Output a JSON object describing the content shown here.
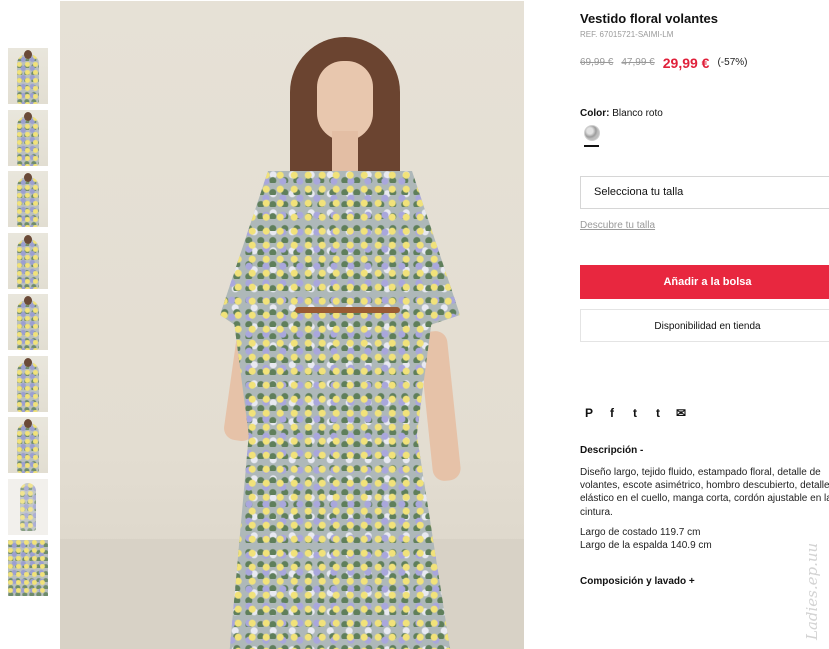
{
  "product": {
    "title": "Vestido floral volantes",
    "ref": "REF. 67015721-SAIMI-LM",
    "price_original_1": "69,99 €",
    "price_original_2": "47,99 €",
    "price_current": "29,99 €",
    "discount": "(-57%)"
  },
  "color": {
    "label": "Color:",
    "value": "Blanco roto",
    "swatch_icon": "patterned-swatch-icon"
  },
  "size": {
    "select_label": "Selecciona tu talla",
    "discover_link": "Descubre tu talla"
  },
  "actions": {
    "add_to_bag": "Añadir a la bolsa",
    "store_availability": "Disponibilidad en tienda"
  },
  "share": {
    "pinterest": "P",
    "facebook": "f",
    "twitter": "t",
    "tumblr": "t",
    "email": "✉"
  },
  "description": {
    "heading": "Descripción -",
    "lines": [
      "Diseño largo, tejido fluido, estampado floral, detalle de",
      "volantes, escote asimétrico, hombro descubierto, detalle",
      "elástico en el cuello, manga corta, cordón ajustable en la",
      "cintura."
    ],
    "measure_1": "Largo de costado 119.7 cm",
    "measure_2": "Largo de la espalda 140.9 cm"
  },
  "composition": {
    "heading": "Composición y lavado +"
  },
  "watermark": "Ladies.ep.uu",
  "colors": {
    "accent": "#e8273f",
    "price_red": "#e0203a",
    "muted": "#9a9a9a"
  }
}
